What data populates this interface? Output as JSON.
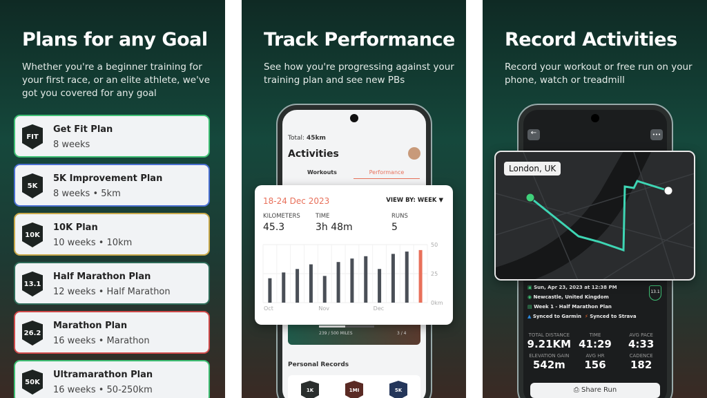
{
  "panel1": {
    "title": "Plans for any Goal",
    "subtitle": "Whether you're a beginner training for your first race, or an elite athlete, we've got you covered for any goal",
    "plans": [
      {
        "badge": "FIT",
        "name": "Get Fit Plan",
        "meta": "8 weeks",
        "color": "#3fbf74"
      },
      {
        "badge": "5K",
        "name": "5K Improvement Plan",
        "meta": "8 weeks • 5km",
        "color": "#4a6fd1"
      },
      {
        "badge": "10K",
        "name": "10K Plan",
        "meta": "10 weeks • 10km",
        "color": "#c9a94a"
      },
      {
        "badge": "13.1",
        "name": "Half Marathon Plan",
        "meta": "12 weeks • Half Marathon",
        "color": "#2e6b58"
      },
      {
        "badge": "26.2",
        "name": "Marathon Plan",
        "meta": "16 weeks • Marathon",
        "color": "#d04a4a"
      },
      {
        "badge": "50K",
        "name": "Ultramarathon Plan",
        "meta": "16 weeks • 50-250km",
        "color": "#3fbf74"
      }
    ]
  },
  "panel2": {
    "title": "Track Performance",
    "subtitle": "See how you're progressing against your training plan and see new PBs",
    "total_label": "Total:",
    "total_value": "45km",
    "screen_title": "Activities",
    "tabs": [
      "Workouts",
      "Performance"
    ],
    "progress_text": "239 / 500 MILES",
    "progress_count": "3 / 4",
    "progress_fraction": 0.478,
    "records_title": "Personal Records",
    "records": [
      "1K",
      "1MI",
      "5K"
    ],
    "card": {
      "date": "18-24 Dec 2023",
      "view_by": "VIEW BY: WEEK",
      "stats": [
        {
          "label": "KILOMETERS",
          "value": "45.3"
        },
        {
          "label": "TIME",
          "value": "3h 48m"
        },
        {
          "label": "RUNS",
          "value": "5"
        }
      ]
    },
    "accent": "#e8705a"
  },
  "chart_data": {
    "type": "bar",
    "x_tick_labels": [
      "Oct",
      "Nov",
      "Dec"
    ],
    "y_tick_labels": [
      "50",
      "25",
      "0km"
    ],
    "ylim": [
      0,
      50
    ],
    "values": [
      21,
      26,
      29,
      33,
      23,
      35,
      38,
      40,
      29,
      42,
      44,
      45.3
    ],
    "highlight_index": 11,
    "bar_color": "#4a4f57",
    "highlight_color": "#e8705a",
    "grid": true
  },
  "panel3": {
    "title": "Record Activities",
    "subtitle": "Record your workout or free run on your phone, watch or treadmill",
    "map_label": "London, UK",
    "date": "Sun, Apr 23, 2023 at 12:38 PM",
    "location": "Newcastle, United Kingdom",
    "plan": "Week 1 - Half Marathon Plan",
    "garmin": "Synced to Garmin",
    "strava": "Synced to Strava",
    "badge": "13.1",
    "stats": [
      {
        "label": "TOTAL DISTANCE",
        "value": "9.21KM"
      },
      {
        "label": "TIME",
        "value": "41:29"
      },
      {
        "label": "AVG PACE",
        "value": "4:33"
      },
      {
        "label": "ELEVATION GAIN",
        "value": "542m"
      },
      {
        "label": "AVG HR",
        "value": "156"
      },
      {
        "label": "CADENCE",
        "value": "182"
      }
    ],
    "share": "Share Run",
    "route_color": "#3ed6b4"
  }
}
